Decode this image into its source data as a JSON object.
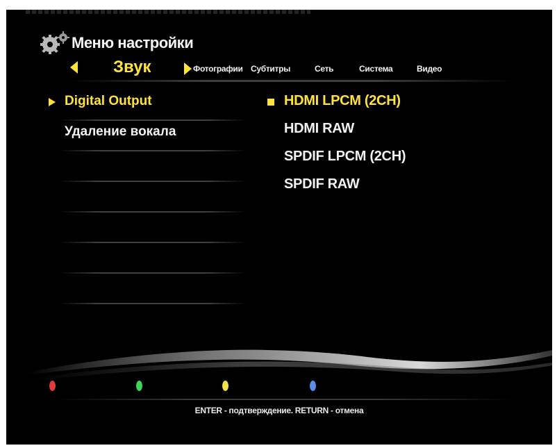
{
  "header": {
    "title": "Меню настройки",
    "icon": "gears-icon"
  },
  "tabs": {
    "active": "Звук",
    "items": [
      "Фотографии",
      "Субтитры",
      "Сеть",
      "Система",
      "Видео"
    ]
  },
  "settings": {
    "items": [
      {
        "label": "Digital Output",
        "selected": true
      },
      {
        "label": "Удаление вокала",
        "selected": false
      }
    ]
  },
  "options": {
    "items": [
      {
        "label": "HDMI LPCM (2CH)",
        "selected": true
      },
      {
        "label": "HDMI RAW",
        "selected": false
      },
      {
        "label": "SPDIF LPCM (2CH)",
        "selected": false
      },
      {
        "label": "SPDIF RAW",
        "selected": false
      }
    ]
  },
  "color_buttons": [
    {
      "name": "red-button",
      "color": "#e23b3b"
    },
    {
      "name": "green-button",
      "color": "#3fd45a"
    },
    {
      "name": "yellow-button",
      "color": "#f2e04a"
    },
    {
      "name": "blue-button",
      "color": "#5a8fe8"
    }
  ],
  "colors": {
    "accent": "#ffe23c",
    "text": "#f0f0f0",
    "background": "#000000"
  },
  "footer": {
    "hint": "ENTER - подтверждение. RETURN - отмена"
  }
}
